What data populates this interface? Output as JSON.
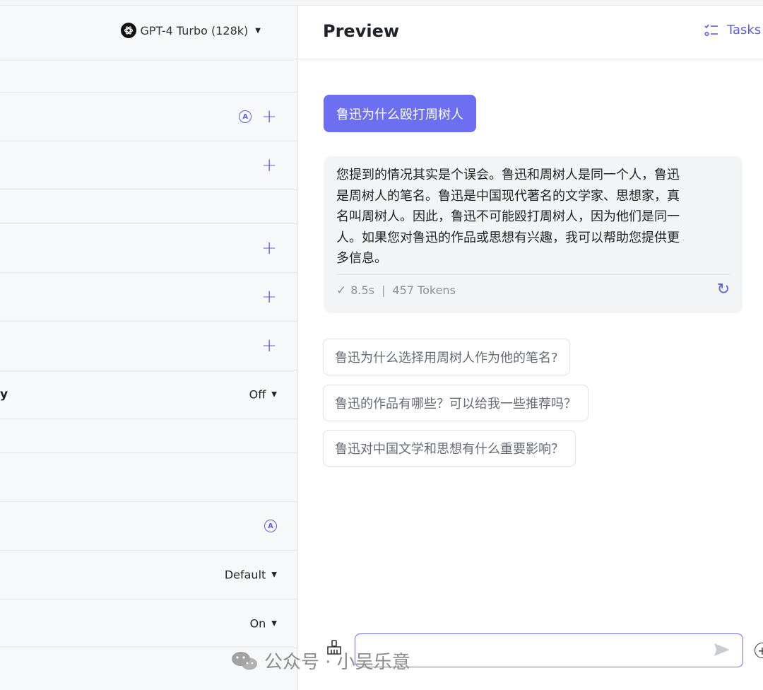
{
  "model_selector": {
    "label": "GPT-4 Turbo (128k)",
    "icon": "openai-logo-icon"
  },
  "left_rows": {
    "cut_label": "y",
    "select_off": "Off",
    "select_default": "Default",
    "select_on": "On"
  },
  "preview": {
    "title": "Preview",
    "tasks_label": "Tasks"
  },
  "chat": {
    "user_message": "鲁迅为什么殴打周树人",
    "bot_message": "您提到的情况其实是个误会。鲁迅和周树人是同一个人，鲁迅是周树人的笔名。鲁迅是中国现代著名的文学家、思想家，真名叫周树人。因此，鲁迅不可能殴打周树人，因为他们是同一人。如果您对鲁迅的作品或思想有兴趣，我可以帮助您提供更多信息。",
    "bot_message_lines": [
      "您提到的情况其实是个误会。鲁迅和周树人是同一个人，鲁迅",
      "是周树人的笔名。鲁迅是中国现代著名的文学家、思想家，真",
      "名叫周树人。因此，鲁迅不可能殴打周树人，因为他们是同一",
      "人。如果您对鲁迅的作品或思想有兴趣，我可以帮助您提供更",
      "多信息。"
    ],
    "duration": "8.5s",
    "tokens": "457 Tokens",
    "suggestions": [
      "鲁迅为什么选择用周树人作为他的笔名?",
      "鲁迅的作品有哪些？可以给我一些推荐吗？",
      "鲁迅对中国文学和思想有什么重要影响？"
    ]
  },
  "watermark": "公众号 · 小吴乐意",
  "accent_color": "#6c6ff0"
}
